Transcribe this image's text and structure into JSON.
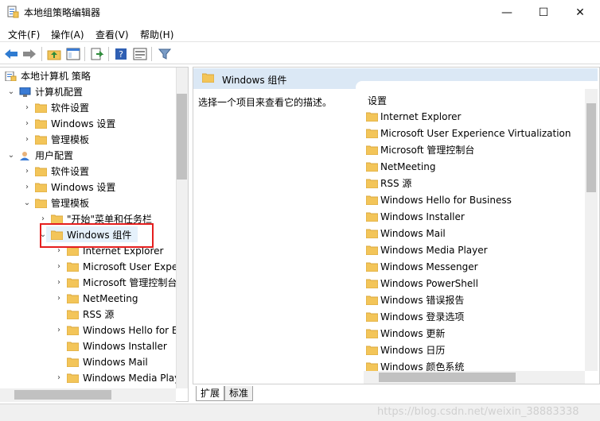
{
  "window": {
    "title": "本地组策略编辑器",
    "minimize": "—",
    "maximize": "☐",
    "close": "✕"
  },
  "menu": [
    "文件(F)",
    "操作(A)",
    "查看(V)",
    "帮助(H)"
  ],
  "colors": {
    "folder": "#f3c559",
    "folder_dark": "#d9a63a",
    "highlight": "#e51e1e",
    "header": "#dbe8f5"
  },
  "tree": [
    {
      "label": "本地计算机 策略",
      "chev": "",
      "icon": "policy"
    },
    {
      "label": "计算机配置",
      "chev": "⌄",
      "icon": "computer"
    },
    {
      "label": "软件设置",
      "chev": "›",
      "icon": "folder"
    },
    {
      "label": "Windows 设置",
      "chev": "›",
      "icon": "folder"
    },
    {
      "label": "管理模板",
      "chev": "›",
      "icon": "folder"
    },
    {
      "label": "用户配置",
      "chev": "⌄",
      "icon": "user"
    },
    {
      "label": "软件设置",
      "chev": "›",
      "icon": "folder"
    },
    {
      "label": "Windows 设置",
      "chev": "›",
      "icon": "folder"
    },
    {
      "label": "管理模板",
      "chev": "⌄",
      "icon": "folder"
    },
    {
      "label": "\"开始\"菜单和任务栏",
      "chev": "›",
      "icon": "folder"
    },
    {
      "label": "Windows 组件",
      "chev": "⌄",
      "icon": "folder"
    },
    {
      "label": "Internet Explorer",
      "chev": "›",
      "icon": "folder"
    },
    {
      "label": "Microsoft User Expe",
      "chev": "›",
      "icon": "folder"
    },
    {
      "label": "Microsoft 管理控制台",
      "chev": "›",
      "icon": "folder"
    },
    {
      "label": "NetMeeting",
      "chev": "›",
      "icon": "folder"
    },
    {
      "label": "RSS 源",
      "chev": "",
      "icon": "folder"
    },
    {
      "label": "Windows Hello for E",
      "chev": "›",
      "icon": "folder"
    },
    {
      "label": "Windows Installer",
      "chev": "",
      "icon": "folder"
    },
    {
      "label": "Windows Mail",
      "chev": "",
      "icon": "folder"
    },
    {
      "label": "Windows Media Play",
      "chev": "›",
      "icon": "folder"
    }
  ],
  "right": {
    "header_title": "Windows 组件",
    "description": "选择一个项目来查看它的描述。",
    "column_header": "设置",
    "items": [
      "Internet Explorer",
      "Microsoft User Experience Virtualization",
      "Microsoft 管理控制台",
      "NetMeeting",
      "RSS 源",
      "Windows Hello for Business",
      "Windows Installer",
      "Windows Mail",
      "Windows Media Player",
      "Windows Messenger",
      "Windows PowerShell",
      "Windows 错误报告",
      "Windows 登录选项",
      "Windows 更新",
      "Windows 日历",
      "Windows 颜色系统"
    ]
  },
  "tabs": [
    "扩展",
    "标准"
  ],
  "watermark": "https://blog.csdn.net/weixin_38883338"
}
